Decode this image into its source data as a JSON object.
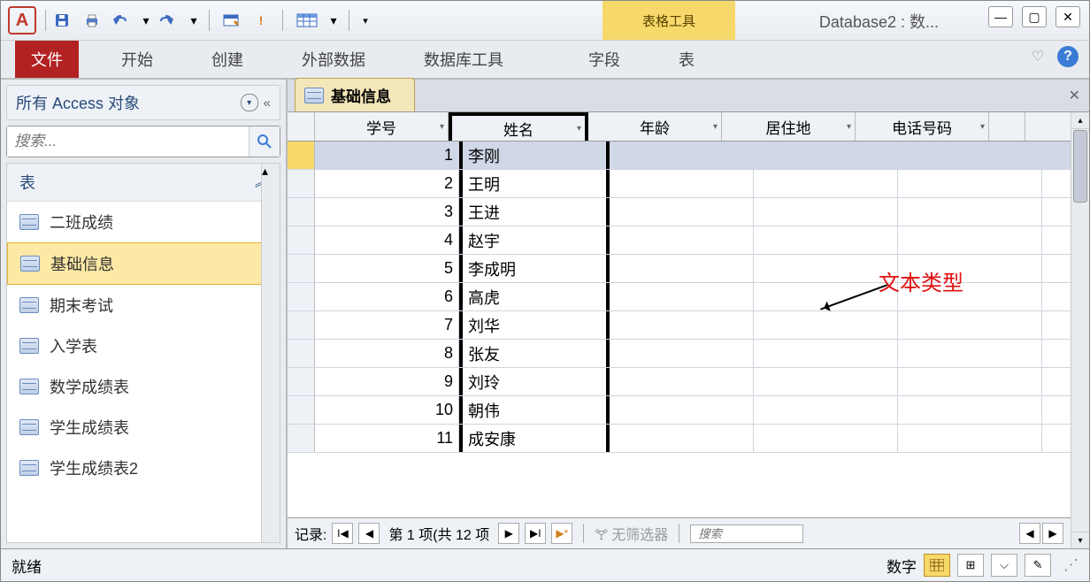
{
  "window": {
    "app_letter": "A",
    "title": "Database2 : 数...",
    "contextual_tab": "表格工具"
  },
  "ribbon": {
    "tabs": [
      "文件",
      "开始",
      "创建",
      "外部数据",
      "数据库工具",
      "字段",
      "表"
    ]
  },
  "nav": {
    "header": "所有 Access 对象",
    "search_placeholder": "搜索...",
    "group": "表",
    "items": [
      "二班成绩",
      "基础信息",
      "期末考试",
      "入学表",
      "数学成绩表",
      "学生成绩表",
      "学生成绩表2"
    ],
    "selected_index": 1
  },
  "doc": {
    "tab_label": "基础信息",
    "columns": [
      "学号",
      "姓名",
      "年龄",
      "居住地",
      "电话号码"
    ],
    "rows": [
      {
        "id": "1",
        "name": "李刚"
      },
      {
        "id": "2",
        "name": "王明"
      },
      {
        "id": "3",
        "name": "王进"
      },
      {
        "id": "4",
        "name": "赵宇"
      },
      {
        "id": "5",
        "name": "李成明"
      },
      {
        "id": "6",
        "name": "高虎"
      },
      {
        "id": "7",
        "name": "刘华"
      },
      {
        "id": "8",
        "name": "张友"
      },
      {
        "id": "9",
        "name": "刘玲"
      },
      {
        "id": "10",
        "name": "朝伟"
      },
      {
        "id": "11",
        "name": "成安康"
      }
    ],
    "annotation": "文本类型"
  },
  "record_nav": {
    "label": "记录:",
    "position": "第 1 项(共 12 项",
    "filter": "无筛选器",
    "search": "搜索"
  },
  "status": {
    "ready": "就绪",
    "mode": "数字"
  }
}
